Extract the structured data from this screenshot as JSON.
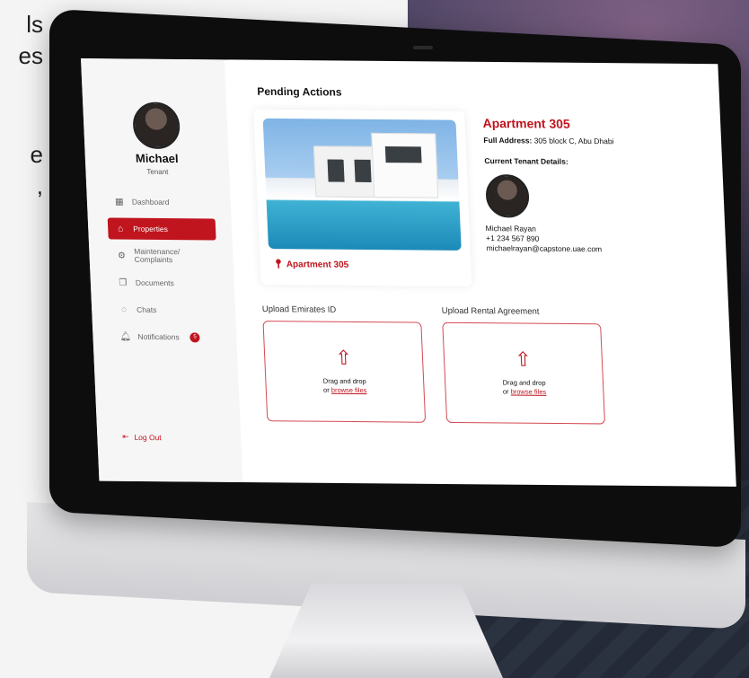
{
  "background_text": [
    "ls",
    "es",
    "",
    "e",
    ","
  ],
  "sidebar": {
    "user_name": "Michael",
    "user_role": "Tenant",
    "items": [
      {
        "label": "Dashboard",
        "icon": "dashboard-icon",
        "active": false
      },
      {
        "label": "Properties",
        "icon": "home-icon",
        "active": true
      },
      {
        "label": "Maintenance/ Complaints",
        "icon": "gear-icon",
        "active": false
      },
      {
        "label": "Documents",
        "icon": "documents-icon",
        "active": false
      },
      {
        "label": "Chats",
        "icon": "chat-icon",
        "active": false
      },
      {
        "label": "Notifications",
        "icon": "bell-icon",
        "active": false,
        "badge": "5"
      }
    ],
    "logout_label": "Log Out"
  },
  "main": {
    "title": "Pending Actions",
    "property": {
      "card_label": "Apartment 305",
      "title": "Apartment 305",
      "address_label": "Full Address:",
      "address_value": "305 block C, Abu Dhabi",
      "tenant_heading": "Current Tenant Details:",
      "tenant_name": "Michael Rayan",
      "tenant_phone": "+1 234 567 890",
      "tenant_email": "michaelrayan@capstone.uae.com"
    },
    "uploads": [
      {
        "label": "Upload Emirates ID",
        "drag_text": "Drag and drop",
        "or_text": "or",
        "browse_text": "browse files"
      },
      {
        "label": "Upload Rental Agreement",
        "drag_text": "Drag and drop",
        "or_text": "or",
        "browse_text": "browse files"
      }
    ]
  },
  "colors": {
    "accent": "#c0141e",
    "sidebar_bg": "#f6f6f6"
  }
}
